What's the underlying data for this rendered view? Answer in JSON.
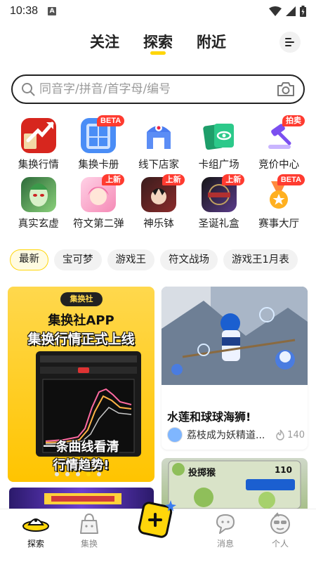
{
  "status": {
    "time": "10:38",
    "notification_letter": "A"
  },
  "top_tabs": [
    {
      "label": "关注"
    },
    {
      "label": "探索"
    },
    {
      "label": "附近"
    }
  ],
  "search": {
    "placeholder": "同音字/拼音/首字母/编号"
  },
  "categories": [
    {
      "label": "集换行情",
      "badge": "",
      "icon": "market-chart-icon"
    },
    {
      "label": "集换卡册",
      "badge": "BETA",
      "icon": "card-album-icon"
    },
    {
      "label": "线下店家",
      "badge": "",
      "icon": "store-icon"
    },
    {
      "label": "卡组广场",
      "badge": "",
      "icon": "deck-plaza-icon"
    },
    {
      "label": "竞价中心",
      "badge": "拍卖",
      "icon": "auction-gavel-icon"
    },
    {
      "label": "真实玄虚",
      "badge": "",
      "icon": "game-avatar-icon"
    },
    {
      "label": "符文第二弹",
      "badge": "上新",
      "icon": "rune-anime-icon"
    },
    {
      "label": "神乐钵",
      "badge": "上新",
      "icon": "kagura-anime-icon"
    },
    {
      "label": "圣诞礼盒",
      "badge": "上新",
      "icon": "duelist-box-icon"
    },
    {
      "label": "赛事大厅",
      "badge": "BETA",
      "icon": "medal-icon"
    }
  ],
  "filters": [
    {
      "label": "最新",
      "active": true
    },
    {
      "label": "宝可梦"
    },
    {
      "label": "游戏王"
    },
    {
      "label": "符文战场"
    },
    {
      "label": "游戏王1月表"
    }
  ],
  "feed": {
    "promo": {
      "logo": "集换社",
      "title1": "集换社APP",
      "title2": "集换行情正式上线",
      "sub1": "一条曲线看清",
      "sub2": "行情趋势!"
    },
    "carousel": {
      "count": 5,
      "active_index": 3
    },
    "post": {
      "title": "水莲和球球海狮!",
      "author": "荔枝成为妖精道...",
      "likes": "140"
    },
    "card": {
      "name": "投掷猴",
      "hp": "110"
    }
  },
  "bottom_nav": [
    {
      "label": "探索",
      "icon": "ufo-explore-icon"
    },
    {
      "label": "集换",
      "icon": "bag-icon"
    },
    {
      "label": "消息",
      "icon": "message-icon"
    },
    {
      "label": "个人",
      "icon": "profile-icon"
    }
  ],
  "colors": {
    "accent": "#ffd60a",
    "badge": "#ff3b30"
  }
}
